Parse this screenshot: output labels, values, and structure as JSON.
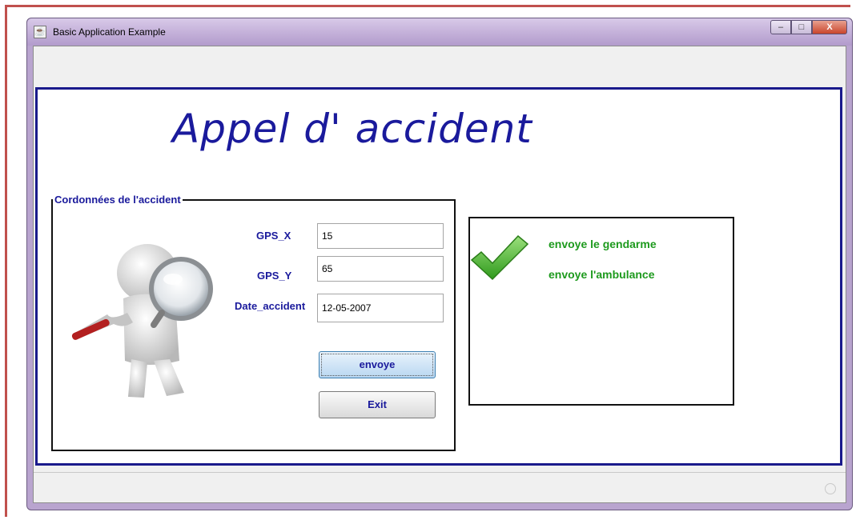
{
  "window": {
    "title": "Basic Application Example",
    "controls": {
      "minimize": "–",
      "maximize": "□",
      "close": "X"
    }
  },
  "page": {
    "title": "Appel d' accident"
  },
  "coordinates_panel": {
    "legend": "Cordonnées de l'accident",
    "fields": [
      {
        "label": "GPS_X",
        "value": "15"
      },
      {
        "label": "GPS_Y",
        "value": "65"
      },
      {
        "label": "Date_accident",
        "value": "12-05-2007"
      }
    ],
    "send_button": "envoye",
    "exit_button": "Exit"
  },
  "result_panel": {
    "lines": [
      "envoye le gendarme",
      "envoye l'ambulance"
    ]
  },
  "colors": {
    "title": "#1a1a9c",
    "success_text": "#1d9a1d",
    "check": "#3fae2a",
    "panel_border": "#1a1a8c"
  }
}
